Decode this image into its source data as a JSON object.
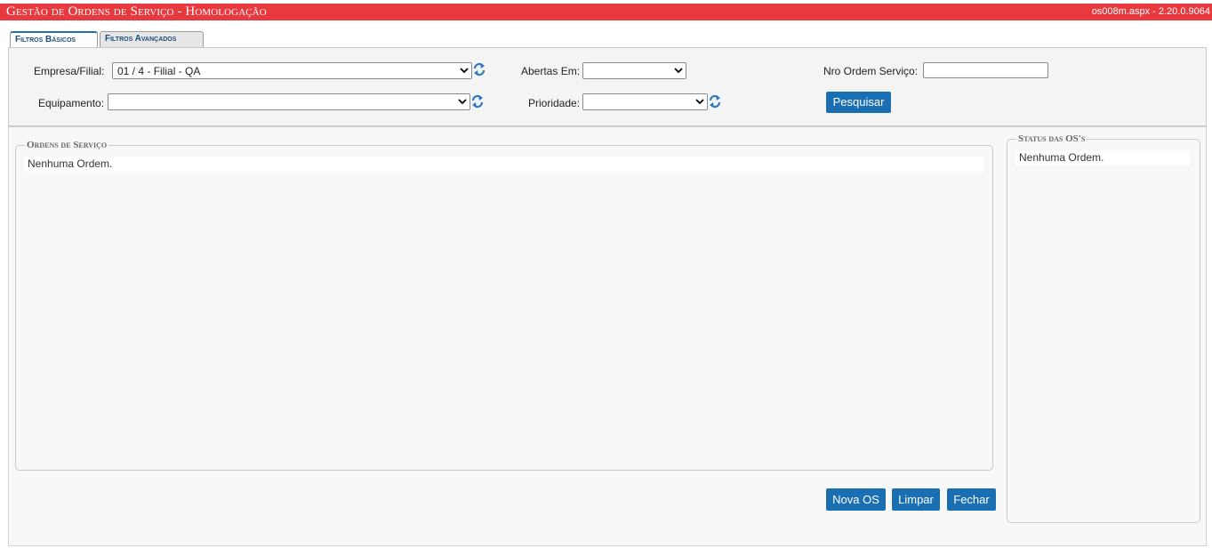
{
  "header": {
    "title": "Gestão de Ordens de Serviço  - Homologação",
    "version": "os008m.aspx - 2.20.0.9064"
  },
  "tabs": [
    {
      "label": "Filtros Básicos",
      "active": true
    },
    {
      "label": "Filtros Avançados",
      "active": false
    }
  ],
  "filters": {
    "empresa_filial": {
      "label": "Empresa/Filial:",
      "value": "01 / 4 - Filial - QA"
    },
    "equipamento": {
      "label": "Equipamento:",
      "value": ""
    },
    "abertas_em": {
      "label": "Abertas Em:",
      "value": ""
    },
    "prioridade": {
      "label": "Prioridade:",
      "value": ""
    },
    "nro_ordem": {
      "label": "Nro Ordem Serviço:",
      "value": ""
    },
    "search_button": "Pesquisar"
  },
  "ordens": {
    "legend": "Ordens de Serviço",
    "empty_text": "Nenhuma Ordem."
  },
  "status": {
    "legend": "Status das OS's",
    "empty_text": "Nenhuma Ordem."
  },
  "actions": {
    "nova_os": "Nova OS",
    "limpar": "Limpar",
    "fechar": "Fechar"
  },
  "colors": {
    "header_bg": "#e8393f",
    "button_bg": "#1a6fb3",
    "refresh_icon": "#2a78c8"
  },
  "icons": [
    "refresh-icon",
    "chevron-down-icon"
  ]
}
